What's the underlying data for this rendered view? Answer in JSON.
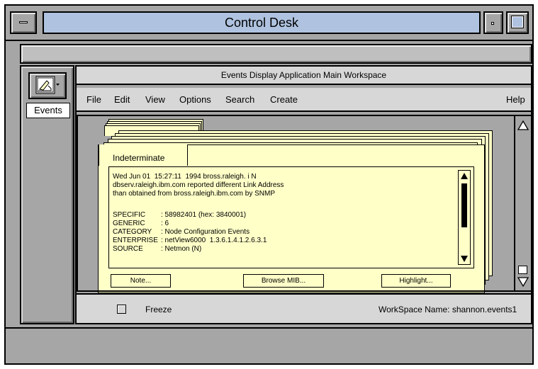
{
  "window": {
    "title": "Control Desk"
  },
  "left_panel": {
    "label": "Events",
    "icon": "events-app-icon"
  },
  "workspace": {
    "title": "Events Display Application Main Workspace",
    "menu": [
      "File",
      "Edit",
      "View",
      "Options",
      "Search",
      "Create"
    ],
    "help": "Help"
  },
  "card": {
    "tab_label": "Indeterminate",
    "line1": "Wed Jun 01  15:27:11  1994 bross.raleigh. i N",
    "line2": "dbserv.raleigh.ibm.com reported different Link Address",
    "line3": "than obtained from bross.raleigh.ibm.com by SNMP",
    "fields": [
      {
        "key": "SPECIFIC",
        "value": ": 58982401 (hex: 3840001)"
      },
      {
        "key": "GENERIC",
        "value": ": 6"
      },
      {
        "key": "CATEGORY",
        "value": ": Node Configuration Events"
      },
      {
        "key": "ENTERPRISE",
        "value": ": netView6000  1.3.6.1.4.1.2.6.3.1"
      },
      {
        "key": "SOURCE",
        "value": ": Netmon (N)"
      }
    ],
    "buttons": {
      "note": "Note...",
      "browse": "Browse MIB...",
      "highlight": "Highlight..."
    }
  },
  "status": {
    "freeze_label": "Freeze",
    "freeze_checked": false,
    "workspace_name": "WorkSpace Name:  shannon.events1"
  },
  "colors": {
    "title_blue": "#afc3e0",
    "card_yellow": "#ffffc8",
    "chrome_gray": "#a6a6a6"
  }
}
